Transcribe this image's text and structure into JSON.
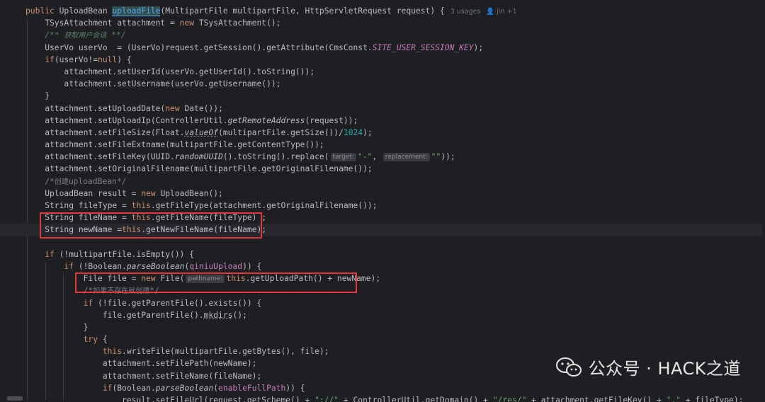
{
  "method_signature": {
    "modifier": "public",
    "return_type": "UploadBean",
    "name": "uploadFile",
    "params": "(MultipartFile multipartFile, HttpServletRequest request) {",
    "usages": "3 usages",
    "author": "jin +1"
  },
  "hints": {
    "target": "target:",
    "replacement": "replacement:",
    "pathname": "pathname:"
  },
  "watermark": {
    "text": "公众号 · HACK之道",
    "icon": "wechat-icon"
  },
  "colors": {
    "background": "#1e1f22",
    "keyword": "#cf8e6d",
    "method": "#56a8f5",
    "string": "#6aab73",
    "highlight_box": "#e5383b"
  }
}
